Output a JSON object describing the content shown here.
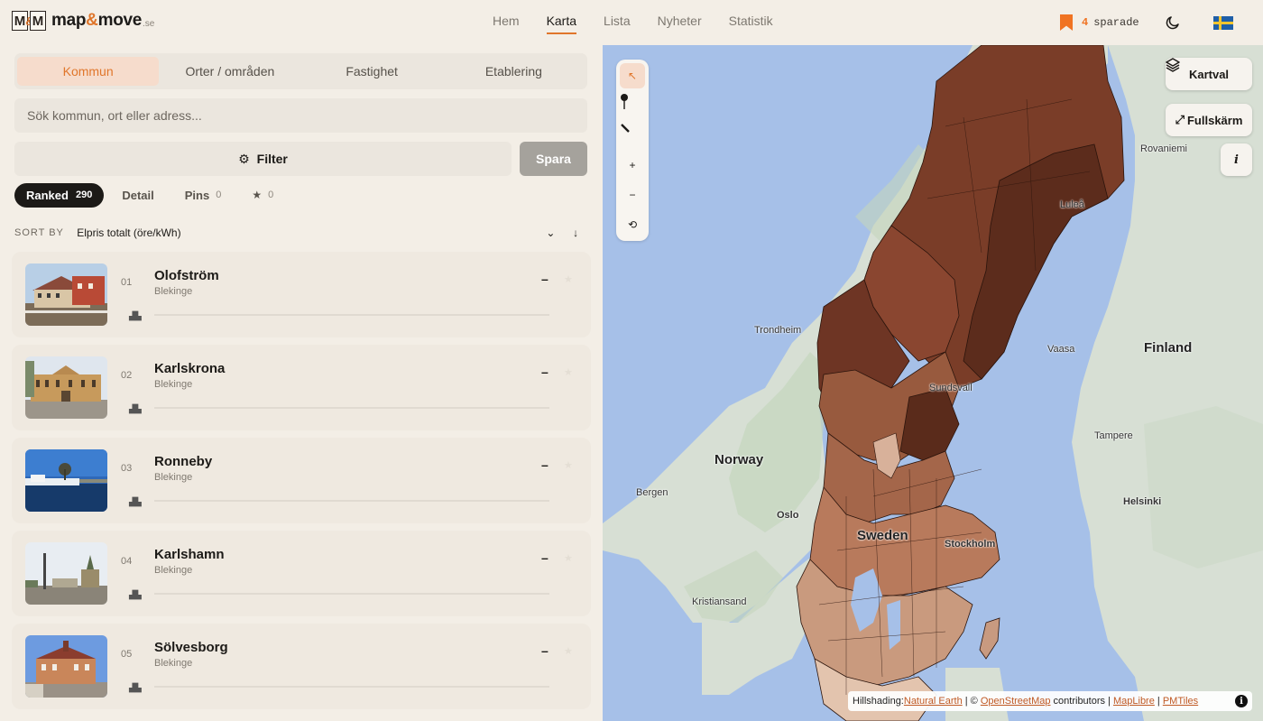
{
  "header": {
    "logo_left": "M",
    "logo_mid": "&",
    "logo_right": "M",
    "brand_main": "map",
    "brand_amp": "&",
    "brand_rest": "move",
    "brand_tld": ".se",
    "nav": [
      "Hem",
      "Karta",
      "Lista",
      "Nyheter",
      "Statistik"
    ],
    "nav_active": "Karta",
    "saved_count": "4",
    "saved_label": "sparade",
    "accent_color": "#e0762b"
  },
  "panel": {
    "tabs": [
      "Kommun",
      "Orter / områden",
      "Fastighet",
      "Etablering"
    ],
    "active_tab": "Kommun",
    "search_placeholder": "Sök kommun, ort eller adress...",
    "filter_label": "Filter",
    "save_label": "Spara",
    "subtabs": [
      {
        "label": "Ranked",
        "count": "290"
      },
      {
        "label": "Detail",
        "count": ""
      },
      {
        "label": "Pins",
        "count": "0"
      },
      {
        "label": "★",
        "count": "0"
      }
    ],
    "sort_by_label": "SORT BY",
    "sort_value": "Elpris totalt (öre/kWh)",
    "rows": [
      {
        "rank": "01",
        "name": "Olofström",
        "region": "Blekinge",
        "value": "–"
      },
      {
        "rank": "02",
        "name": "Karlskrona",
        "region": "Blekinge",
        "value": "–"
      },
      {
        "rank": "03",
        "name": "Ronneby",
        "region": "Blekinge",
        "value": "–"
      },
      {
        "rank": "04",
        "name": "Karlshamn",
        "region": "Blekinge",
        "value": "–"
      },
      {
        "rank": "05",
        "name": "Sölvesborg",
        "region": "Blekinge",
        "value": "–"
      }
    ]
  },
  "map": {
    "layers_label": "Kartval",
    "fullscreen_label": "Fullskärm",
    "info_label": "i",
    "labels": {
      "norway": "Norway",
      "sweden": "Sweden",
      "finland": "Finland",
      "trondheim": "Trondheim",
      "bergen": "Bergen",
      "oslo": "Oslo",
      "kristiansand": "Kristiansand",
      "stockholm": "Stockholm",
      "sundsvall": "Sundsvall",
      "lulea": "Luleå",
      "vaasa": "Vaasa",
      "tampere": "Tampere",
      "helsinki": "Helsinki",
      "rovaniemi": "Rovaniemi"
    },
    "attribution": {
      "prefix": "Hillshading: ",
      "natural_earth": "Natural Earth",
      "sep1": " | © ",
      "osm": "OpenStreetMap",
      "contributors": " contributors | ",
      "maplibre": "MapLibre",
      "sep2": " | ",
      "pmtiles": "PMTiles"
    }
  }
}
